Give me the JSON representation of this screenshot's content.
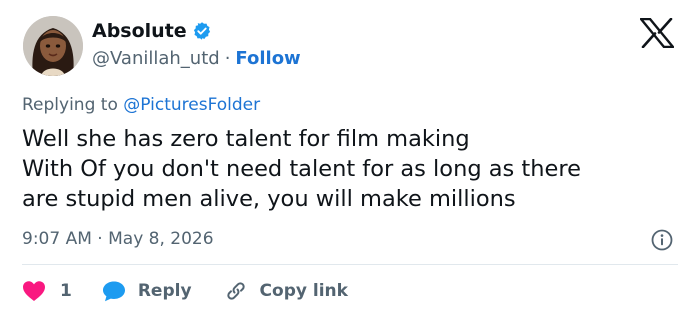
{
  "author": {
    "display_name": "Absolute",
    "handle": "@Vanillah_utd",
    "separator": "·",
    "follow_label": "Follow"
  },
  "reply_context": {
    "prefix": "Replying to ",
    "mention": "@PicturesFolder"
  },
  "tweet": {
    "lines": [
      "Well she has zero talent for film making",
      "With Of you don't need talent for as long as there",
      "are stupid men alive, you will make millions"
    ],
    "time": "9:07 AM",
    "separator": "·",
    "date": "May 8, 2026"
  },
  "actions": {
    "likes_count": "1",
    "reply_label": "Reply",
    "copy_link_label": "Copy link"
  },
  "icons": {
    "verified": "verified-badge-icon",
    "brand": "x-logo-icon",
    "info": "info-icon",
    "like": "heart-icon",
    "reply": "speech-bubble-icon",
    "copy": "link-icon"
  },
  "colors": {
    "accent": "#1d74d4",
    "like": "#f91880",
    "reply": "#1d9bf0",
    "muted": "#536471",
    "text": "#0f1419"
  }
}
